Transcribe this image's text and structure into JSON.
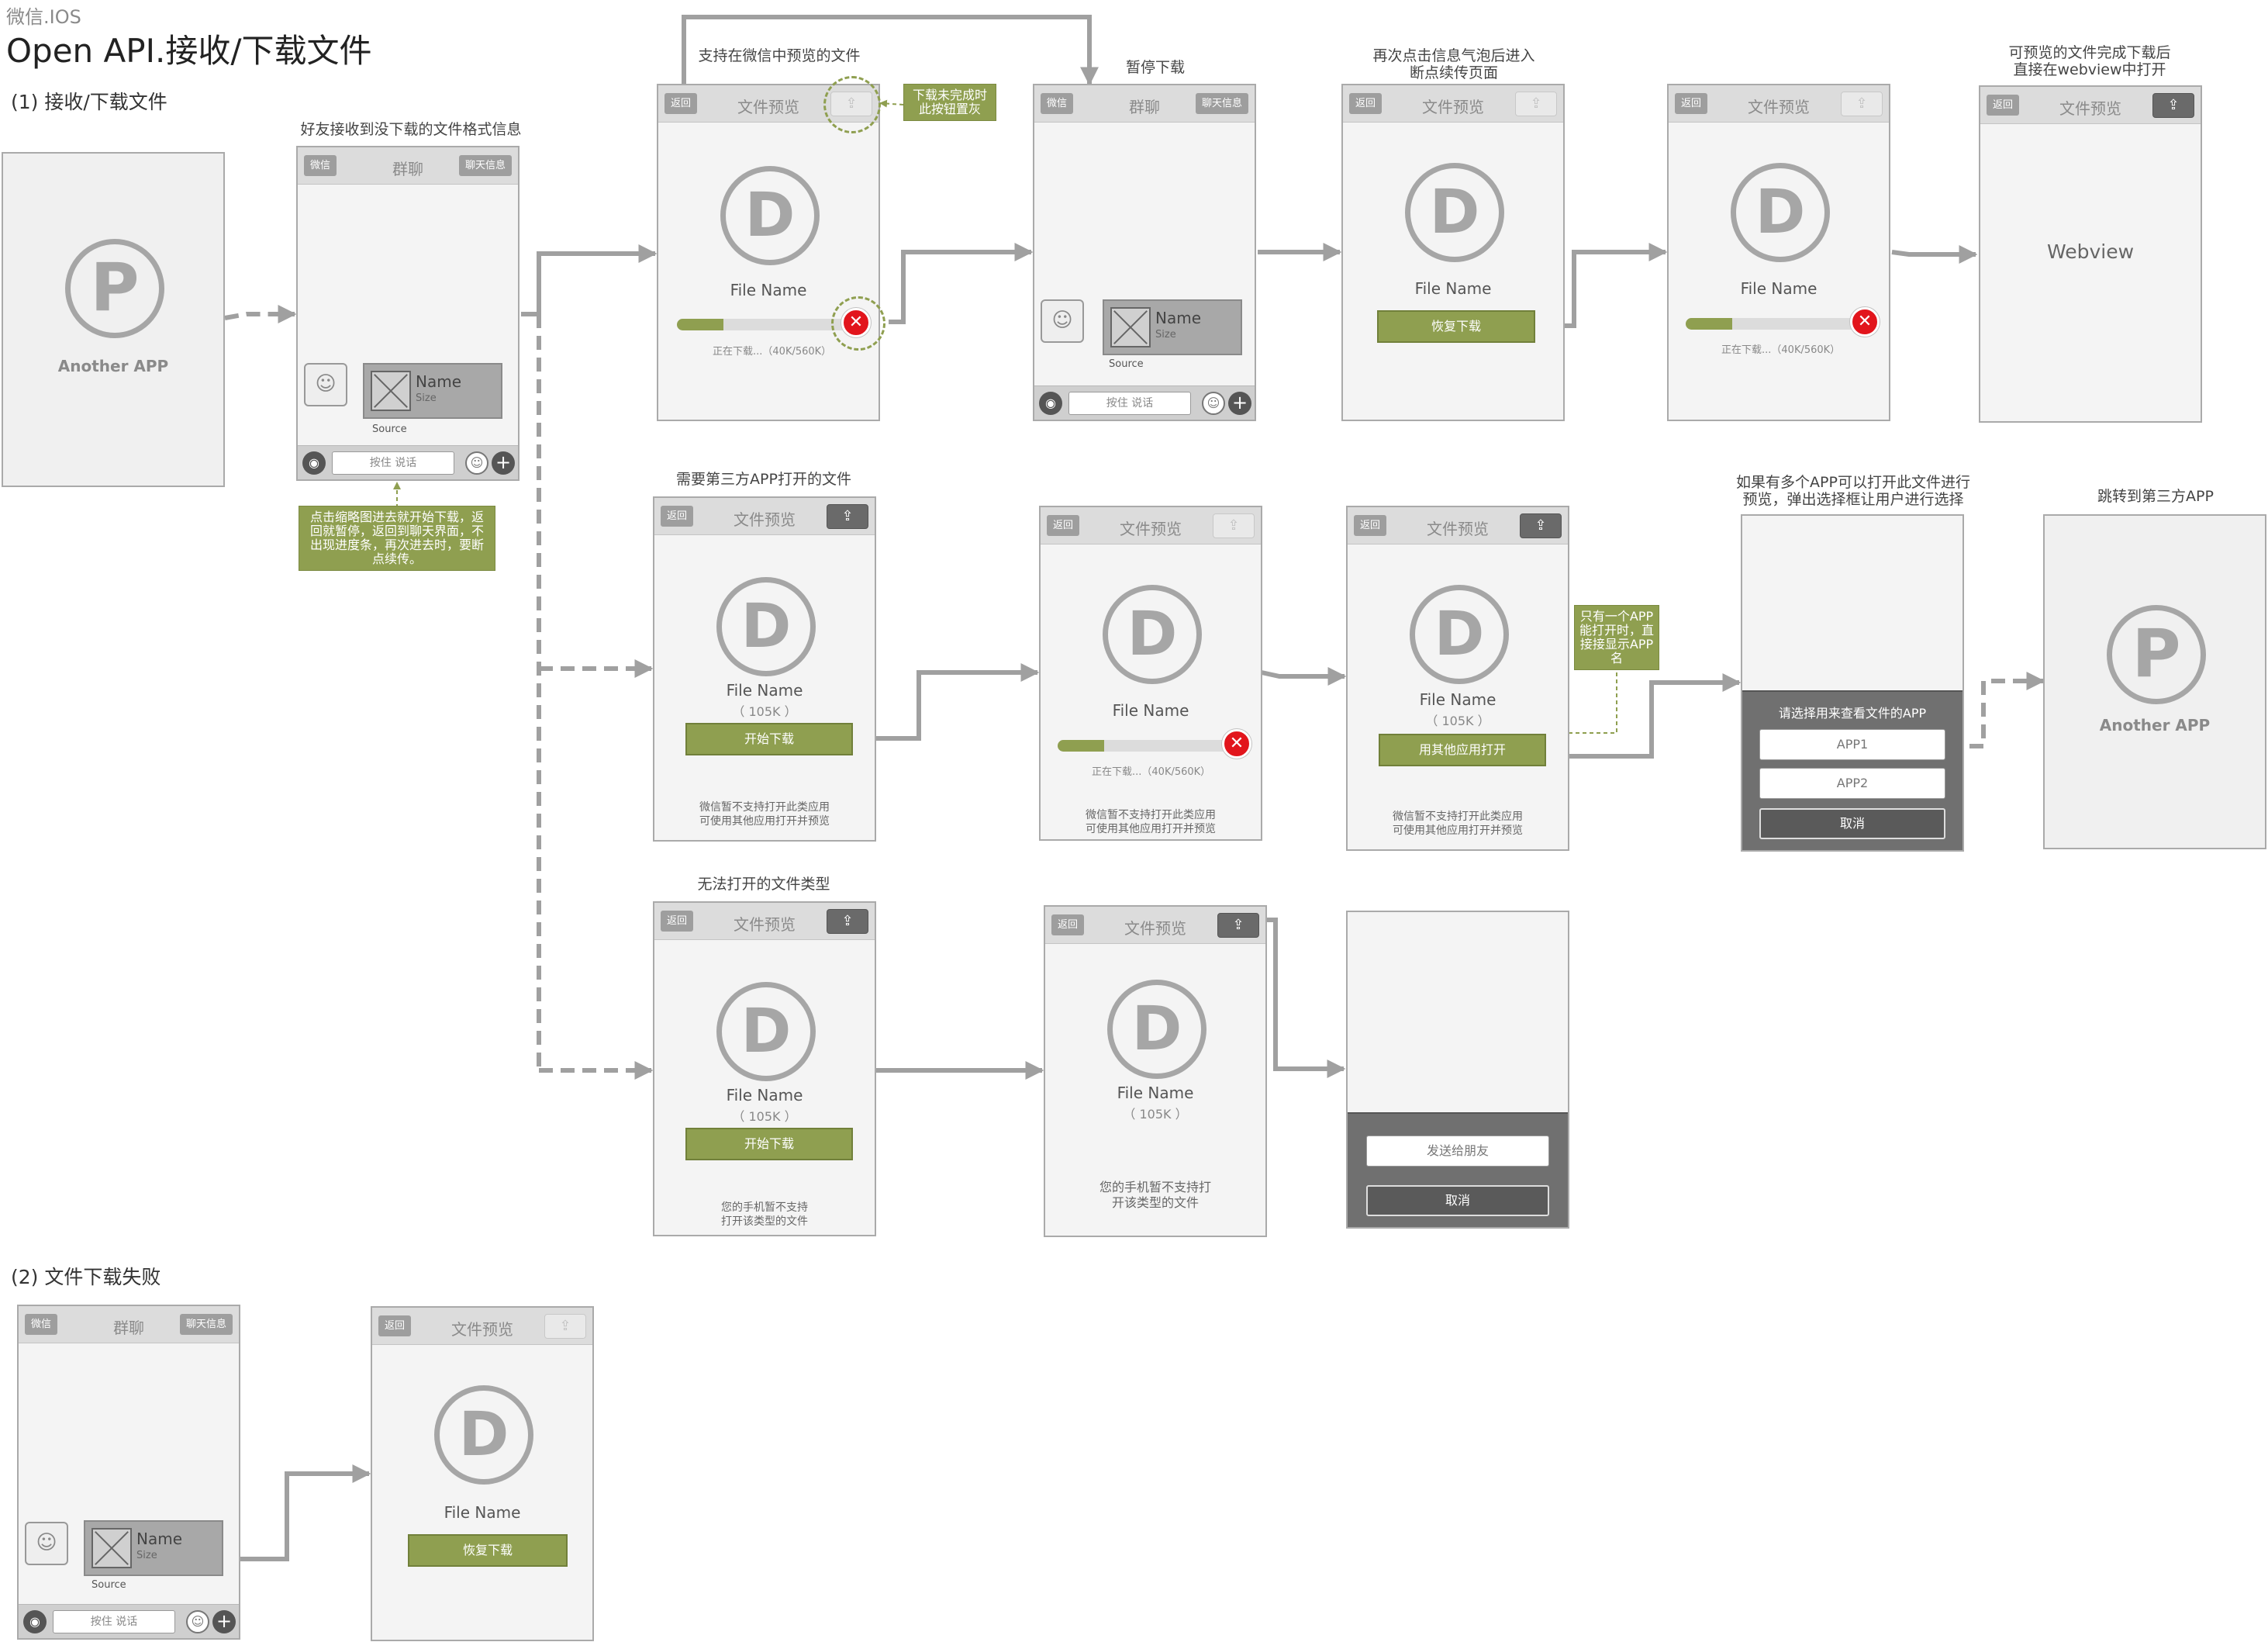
{
  "header": {
    "platform": "微信.IOS",
    "title": "Open API.接收/下载文件"
  },
  "sections": {
    "s1": "(1) 接收/下载文件",
    "s2": "(2) 文件下载失败"
  },
  "captions": {
    "friend_receive": "好友接收到没下载的文件格式信息",
    "wechat_preview": "支持在微信中预览的文件",
    "pause": "暂停下载",
    "resume_1": "再次点击信息气泡后进入",
    "resume_2": "断点续传页面",
    "webview_1": "可预览的文件完成下载后",
    "webview_2": "直接在webview中打开",
    "third_party": "需要第三方APP打开的文件",
    "multi_app_1": "如果有多个APP可以打开此文件进行",
    "multi_app_2": "预览，弹出选择框让用户进行选择",
    "jump_app": "跳转到第三方APP",
    "cannot_open": "无法打开的文件类型"
  },
  "notes": {
    "gray_btn": [
      "下载未完成时",
      "此按钮置灰"
    ],
    "tap_thumb": [
      "点击缩略图进去就开始下载，返",
      "回就暂停，返回到聊天界面，不",
      "出现进度条，再次进去时，要断",
      "点续传。"
    ],
    "one_app": [
      "只有一个APP",
      "能打开时，直",
      "接接显示APP名"
    ]
  },
  "ui": {
    "back": "返回",
    "wechat": "微信",
    "group_chat": "群聊",
    "chat_info": "聊天信息",
    "file_preview": "文件预览",
    "file_name": "File Name",
    "file_size": "（ 105K ）",
    "name": "Name",
    "size": "Size",
    "source": "Source",
    "hold_to_talk": "按住 说话",
    "progress_text": "正在下载...（40K/560K）",
    "progress_ratio": 0.27,
    "resume_download": "恢复下载",
    "start_download": "开始下载",
    "open_with_other": "用其他应用打开",
    "unsupported_1": "微信暂不支持打开此类应用",
    "unsupported_2": "可使用其他应用打开并预览",
    "phone_no_support_1": "您的手机暂不支持",
    "phone_no_support_2": "打开该类型的文件",
    "phone_no_support_b1": "您的手机暂不支持打",
    "phone_no_support_b2": "开该类型的文件",
    "webview": "Webview",
    "another_app": "Another APP",
    "choose_app": "请选择用来查看文件的APP",
    "app1": "APP1",
    "app2": "APP2",
    "cancel": "取消",
    "send_to_friend": "发送给朋友"
  },
  "colors": {
    "accent_green": "#8f9f50",
    "error_red": "#e2151c",
    "wire_gray": "#a0a0a0"
  }
}
